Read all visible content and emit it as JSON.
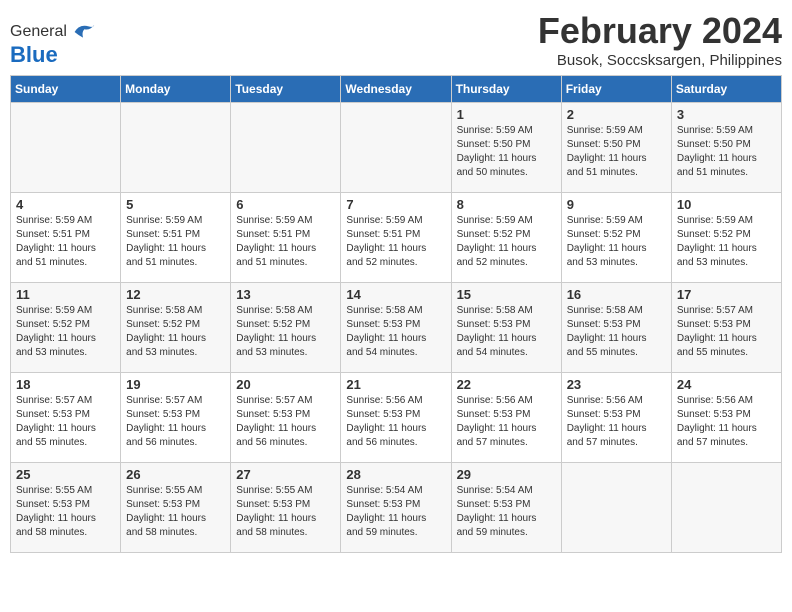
{
  "header": {
    "logo": {
      "general": "General",
      "blue": "Blue"
    },
    "title": "February 2024",
    "location": "Busok, Soccsksargen, Philippines"
  },
  "weekdays": [
    "Sunday",
    "Monday",
    "Tuesday",
    "Wednesday",
    "Thursday",
    "Friday",
    "Saturday"
  ],
  "weeks": [
    [
      {
        "day": "",
        "sunrise": "",
        "sunset": "",
        "daylight": ""
      },
      {
        "day": "",
        "sunrise": "",
        "sunset": "",
        "daylight": ""
      },
      {
        "day": "",
        "sunrise": "",
        "sunset": "",
        "daylight": ""
      },
      {
        "day": "",
        "sunrise": "",
        "sunset": "",
        "daylight": ""
      },
      {
        "day": "1",
        "sunrise": "5:59 AM",
        "sunset": "5:50 PM",
        "daylight": "11 hours and 50 minutes."
      },
      {
        "day": "2",
        "sunrise": "5:59 AM",
        "sunset": "5:50 PM",
        "daylight": "11 hours and 51 minutes."
      },
      {
        "day": "3",
        "sunrise": "5:59 AM",
        "sunset": "5:50 PM",
        "daylight": "11 hours and 51 minutes."
      }
    ],
    [
      {
        "day": "4",
        "sunrise": "5:59 AM",
        "sunset": "5:51 PM",
        "daylight": "11 hours and 51 minutes."
      },
      {
        "day": "5",
        "sunrise": "5:59 AM",
        "sunset": "5:51 PM",
        "daylight": "11 hours and 51 minutes."
      },
      {
        "day": "6",
        "sunrise": "5:59 AM",
        "sunset": "5:51 PM",
        "daylight": "11 hours and 51 minutes."
      },
      {
        "day": "7",
        "sunrise": "5:59 AM",
        "sunset": "5:51 PM",
        "daylight": "11 hours and 52 minutes."
      },
      {
        "day": "8",
        "sunrise": "5:59 AM",
        "sunset": "5:52 PM",
        "daylight": "11 hours and 52 minutes."
      },
      {
        "day": "9",
        "sunrise": "5:59 AM",
        "sunset": "5:52 PM",
        "daylight": "11 hours and 53 minutes."
      },
      {
        "day": "10",
        "sunrise": "5:59 AM",
        "sunset": "5:52 PM",
        "daylight": "11 hours and 53 minutes."
      }
    ],
    [
      {
        "day": "11",
        "sunrise": "5:59 AM",
        "sunset": "5:52 PM",
        "daylight": "11 hours and 53 minutes."
      },
      {
        "day": "12",
        "sunrise": "5:58 AM",
        "sunset": "5:52 PM",
        "daylight": "11 hours and 53 minutes."
      },
      {
        "day": "13",
        "sunrise": "5:58 AM",
        "sunset": "5:52 PM",
        "daylight": "11 hours and 53 minutes."
      },
      {
        "day": "14",
        "sunrise": "5:58 AM",
        "sunset": "5:53 PM",
        "daylight": "11 hours and 54 minutes."
      },
      {
        "day": "15",
        "sunrise": "5:58 AM",
        "sunset": "5:53 PM",
        "daylight": "11 hours and 54 minutes."
      },
      {
        "day": "16",
        "sunrise": "5:58 AM",
        "sunset": "5:53 PM",
        "daylight": "11 hours and 55 minutes."
      },
      {
        "day": "17",
        "sunrise": "5:57 AM",
        "sunset": "5:53 PM",
        "daylight": "11 hours and 55 minutes."
      }
    ],
    [
      {
        "day": "18",
        "sunrise": "5:57 AM",
        "sunset": "5:53 PM",
        "daylight": "11 hours and 55 minutes."
      },
      {
        "day": "19",
        "sunrise": "5:57 AM",
        "sunset": "5:53 PM",
        "daylight": "11 hours and 56 minutes."
      },
      {
        "day": "20",
        "sunrise": "5:57 AM",
        "sunset": "5:53 PM",
        "daylight": "11 hours and 56 minutes."
      },
      {
        "day": "21",
        "sunrise": "5:56 AM",
        "sunset": "5:53 PM",
        "daylight": "11 hours and 56 minutes."
      },
      {
        "day": "22",
        "sunrise": "5:56 AM",
        "sunset": "5:53 PM",
        "daylight": "11 hours and 57 minutes."
      },
      {
        "day": "23",
        "sunrise": "5:56 AM",
        "sunset": "5:53 PM",
        "daylight": "11 hours and 57 minutes."
      },
      {
        "day": "24",
        "sunrise": "5:56 AM",
        "sunset": "5:53 PM",
        "daylight": "11 hours and 57 minutes."
      }
    ],
    [
      {
        "day": "25",
        "sunrise": "5:55 AM",
        "sunset": "5:53 PM",
        "daylight": "11 hours and 58 minutes."
      },
      {
        "day": "26",
        "sunrise": "5:55 AM",
        "sunset": "5:53 PM",
        "daylight": "11 hours and 58 minutes."
      },
      {
        "day": "27",
        "sunrise": "5:55 AM",
        "sunset": "5:53 PM",
        "daylight": "11 hours and 58 minutes."
      },
      {
        "day": "28",
        "sunrise": "5:54 AM",
        "sunset": "5:53 PM",
        "daylight": "11 hours and 59 minutes."
      },
      {
        "day": "29",
        "sunrise": "5:54 AM",
        "sunset": "5:53 PM",
        "daylight": "11 hours and 59 minutes."
      },
      {
        "day": "",
        "sunrise": "",
        "sunset": "",
        "daylight": ""
      },
      {
        "day": "",
        "sunrise": "",
        "sunset": "",
        "daylight": ""
      }
    ]
  ]
}
